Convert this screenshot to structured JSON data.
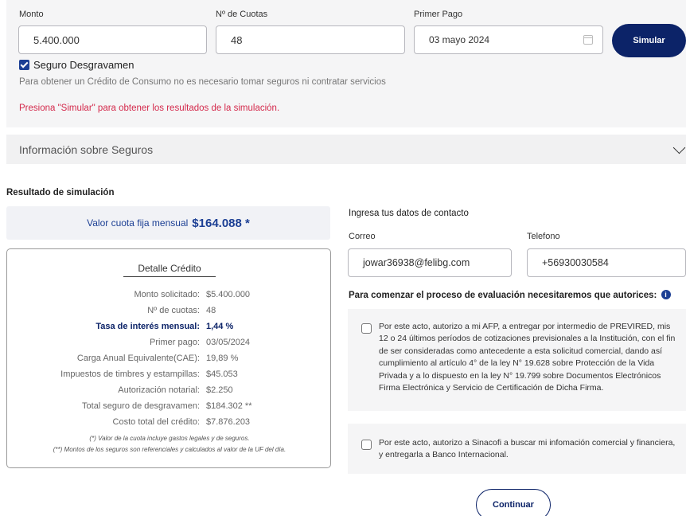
{
  "form": {
    "monto_label": "Monto",
    "monto_value": "5.400.000",
    "cuotas_label": "Nº de Cuotas",
    "cuotas_value": "48",
    "primer_pago_label": "Primer Pago",
    "primer_pago_value": "03 mayo 2024",
    "simular_button": "Simular",
    "seguro_label": "Seguro Desgravamen",
    "seguro_checked": true,
    "disclaimer": "Para obtener un Crédito de Consumo no es necesario tomar seguros ni contratar servicios",
    "warning": "Presiona \"Simular\" para obtener los resultados de la simulación."
  },
  "seguros_section": {
    "title": "Información sobre Seguros"
  },
  "resultado": {
    "title": "Resultado de simulación",
    "cuota_label": "Valor cuota fija mensual",
    "cuota_value": "$164.088 *",
    "detalle_title": "Detalle Crédito",
    "rows": [
      {
        "label": "Monto solicitado:",
        "value": "$5.400.000"
      },
      {
        "label": "Nº de cuotas:",
        "value": "48"
      },
      {
        "label": "Tasa de interés mensual:",
        "value": "1,44 %"
      },
      {
        "label": "Primer pago:",
        "value": "03/05/2024"
      },
      {
        "label": "Carga Anual Equivalente(CAE):",
        "value": "19,89 %"
      },
      {
        "label": "Impuestos de timbres y estampillas:",
        "value": "$45.053"
      },
      {
        "label": "Autorización notarial:",
        "value": "$2.250"
      },
      {
        "label": "Total seguro de desgravamen:",
        "value": "$184.302 **"
      },
      {
        "label": "Costo total del crédito:",
        "value": "$7.876.203"
      }
    ],
    "note1": "(*) Valor de la cuota incluye gastos legales y de seguros.",
    "note2": "(**) Montos de los seguros son referenciales y calculados al valor de la UF del día."
  },
  "contacto": {
    "title": "Ingresa tus datos de contacto",
    "correo_label": "Correo",
    "correo_value": "jowar36938@felibg.com",
    "telefono_label": "Telefono",
    "telefono_value": "+56930030584",
    "autorizacion_title": "Para comenzar el proceso de evaluación necesitaremos que autorices:",
    "info_icon": "i",
    "auth1": "Por este acto, autorizo a mi AFP, a entregar por intermedio de PREVIRED, mis 12 o 24 últimos períodos de cotizaciones previsionales a la Institución, con el fin de ser consideradas como antecedente a esta solicitud comercial, dando así cumplimiento al artículo 4° de la ley N° 19.628 sobre Protección de la Vida Privada y a lo dispuesto en la ley N° 19.799 sobre Documentos Electrónicos Firma Electrónica y Servicio de Certificación de Dicha Firma.",
    "auth2": "Por este acto, autorizo a Sinacofi a buscar mi infomación comercial y financiera, y entregarla a Banco Internacional.",
    "continuar_button": "Continuar"
  },
  "colors": {
    "primary": "#0c2368",
    "accent": "#1c3f94",
    "warning": "#d42a4c",
    "panel": "#f5f5f6"
  }
}
